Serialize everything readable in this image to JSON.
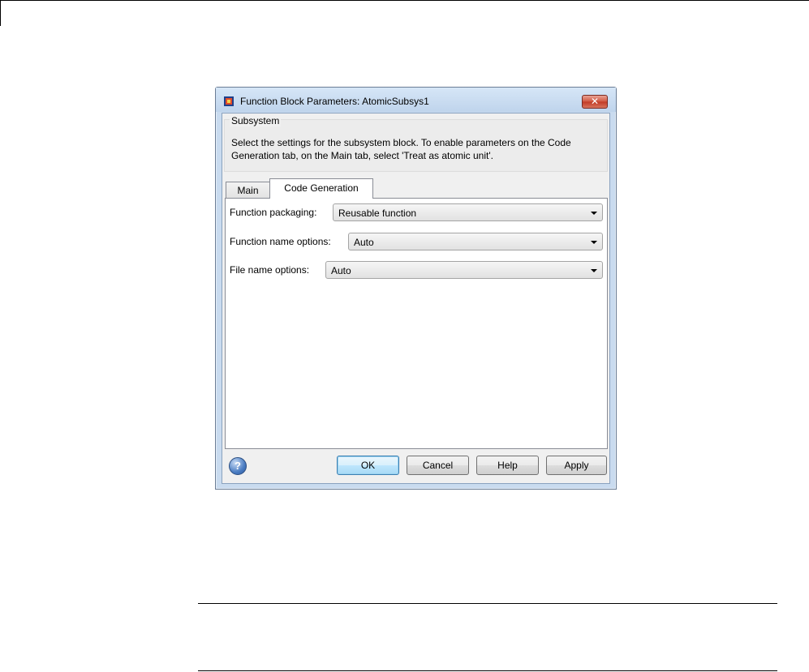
{
  "dialog": {
    "title": "Function Block Parameters: AtomicSubsys1",
    "close_label": "✕",
    "icon": "simulink-block-icon",
    "subsystem_group": {
      "title": "Subsystem",
      "description": "Select the settings for the subsystem block. To enable parameters on the Code Generation tab, on the Main tab, select 'Treat as atomic unit'."
    },
    "tabs": [
      {
        "label": "Main",
        "selected": false
      },
      {
        "label": "Code Generation",
        "selected": true
      }
    ],
    "fields": [
      {
        "label": "Function packaging:",
        "value": "Reusable function"
      },
      {
        "label": "Function name options:",
        "value": "Auto"
      },
      {
        "label": "File name options:",
        "value": "Auto"
      }
    ],
    "help_icon_label": "?",
    "buttons": {
      "ok": "OK",
      "cancel": "Cancel",
      "help": "Help",
      "apply": "Apply"
    }
  }
}
